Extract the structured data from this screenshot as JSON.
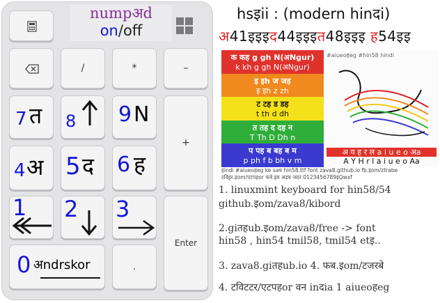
{
  "numpad": {
    "title_line1": "numpअd",
    "on": "on",
    "slash_off": "/off",
    "keys": {
      "calc": "",
      "backspace": "",
      "divide": "/",
      "multiply": "*",
      "minus": "–",
      "plus": "+",
      "enter": "Enter",
      "dot": "."
    },
    "labels": {
      "k7": "7",
      "k7h": "त",
      "k8": "8",
      "k9": "9",
      "k9h": "N",
      "k4": "4",
      "k4h": "अ",
      "k5": "5",
      "k5h": "द",
      "k6": "6",
      "k6h": "ह",
      "k1": "1",
      "k2": "2",
      "k3": "3",
      "k0": "0",
      "k0h": "अndrskor"
    }
  },
  "panel": {
    "title": "hsइii : (modern hinदi)",
    "demo": [
      {
        "t": "अ",
        "c": "r"
      },
      {
        "t": "41इइइ",
        "c": "k"
      },
      {
        "t": "द",
        "c": "r"
      },
      {
        "t": "44इइइ",
        "c": "k"
      },
      {
        "t": "त",
        "c": "r"
      },
      {
        "t": "48इइइ ",
        "c": "k"
      },
      {
        "t": "ह",
        "c": "r"
      },
      {
        "t": "54इइ",
        "c": "k"
      }
    ],
    "chart_rows": [
      {
        "bg": "#e0322c",
        "fg": "#ffffff",
        "l1": "क कह g gh N(अNgur)",
        "l2": "k kh g gh N(अNgur)"
      },
      {
        "bg": "#f08a1e",
        "fg": "#ffffff",
        "l1": "इ इh ज जह",
        "l2": "इ इh z zh"
      },
      {
        "bg": "#f4e11a",
        "fg": "#111111",
        "l1": "ट टह ड डह",
        "l2": "t th d dh"
      },
      {
        "bg": "#2fae3a",
        "fg": "#ffffff",
        "l1": "त तह द दह न",
        "l2": "T Th D Dh n"
      },
      {
        "bg": "#3a3ad0",
        "fg": "#ffffff",
        "l1": "प पह ब बह ब म",
        "l2": "p ph f b bh v m"
      }
    ],
    "photo_caption": "#aiueoहeg #hin58 hindi",
    "photo_row1": "अ य ह र ल a i u e o अa",
    "photo_row2": "А Y H r l a i u e o Aa",
    "foot1": "हindi #aiueoहeg ke saथ hin58.ttf font zava8.github.io fb.इom/ztrabe",
    "foot2": "टविट्टर.इom/एटपहor फवे इव अडब जदर 0123456789इQwxf",
    "lines": [
      "1. linuxmint keyboard for hin58/54",
      "github.इom/zava8/kibord",
      "2.giतहub.इom/zava8/free -> font",
      "hin58 , hin54 tmil58, tmil54 etइ..",
      "3. zava8.giतहub.io  4. फब.इom/टजरबे",
      "4. टविटटर/एटपहor वन inदia 1 aiueoहeg"
    ]
  },
  "colors": {
    "accent_blue": "#1515d6",
    "accent_red": "#e02020",
    "title_purple": "#8a2e98"
  }
}
